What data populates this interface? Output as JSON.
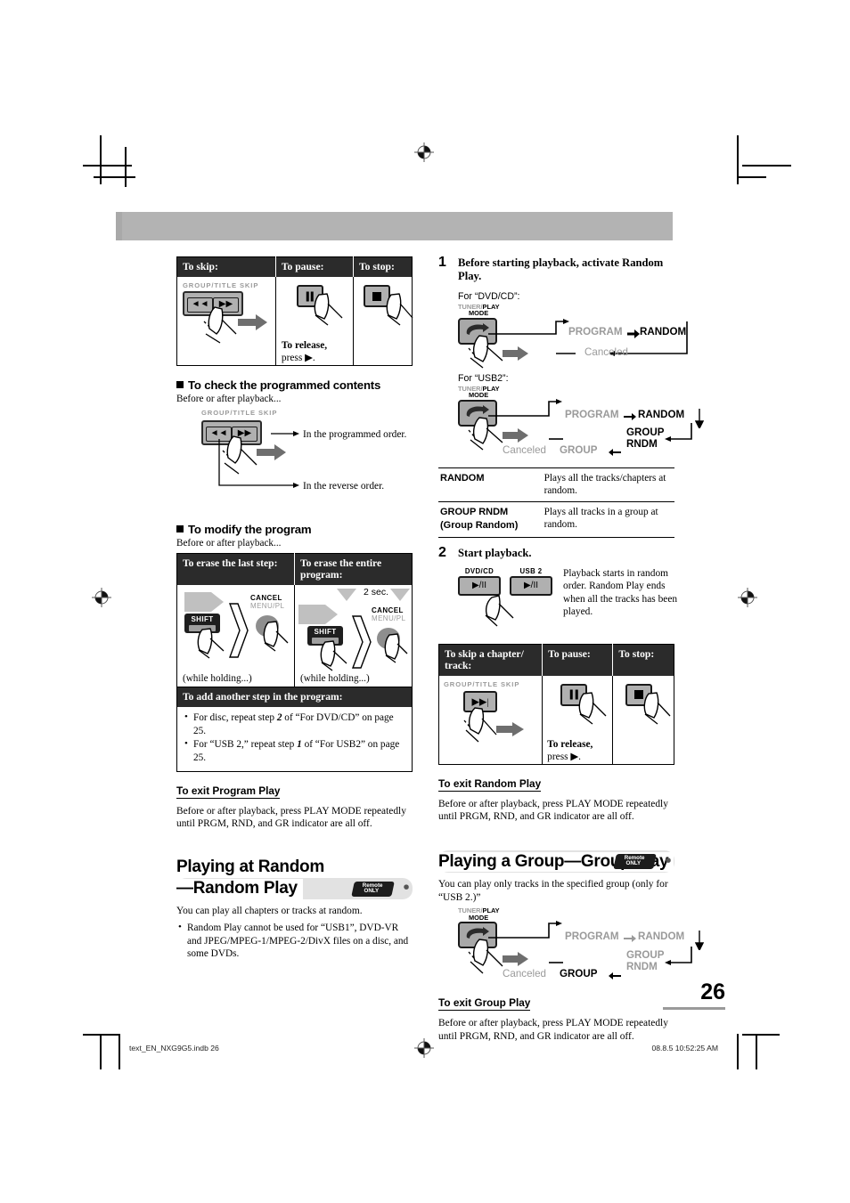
{
  "page": {
    "number": "26"
  },
  "footer": {
    "file": "text_EN_NXG9G5.indb   26",
    "stamp": "08.8.5   10:52:25 AM"
  },
  "left_column": {
    "skip_table": {
      "headers": [
        "To skip:",
        "To pause:",
        "To stop:"
      ],
      "skip_label": "GROUP/TITLE SKIP",
      "pause_note_bold": "To release,",
      "pause_note_rest": "press ▶."
    },
    "check_section": {
      "heading": "To check the programmed contents",
      "pre": "Before or after playback...",
      "skip_label": "GROUP/TITLE SKIP",
      "note_top": "In the programmed order.",
      "note_bottom": "In the reverse order."
    },
    "modify_section": {
      "heading": "To modify the program",
      "pre": "Before or after playback...",
      "headers": [
        "To erase the last step:",
        "To erase the entire program:"
      ],
      "shift_label": "SHIFT",
      "cancel_label": "CANCEL",
      "cancel_sub": "MENU/PL",
      "hold_note": "(while holding...)",
      "two_sec": "2 sec.",
      "band_header": "To add another step in the program:",
      "bullets": [
        "For disc, repeat step 2 of “For DVD/CD” on page 25.",
        "For “USB 2,” repeat step 1 of “For USB2” on page 25."
      ]
    },
    "exit_program": {
      "heading": "To exit Program Play",
      "body": "Before or after playback, press PLAY MODE repeatedly until PRGM, RND, and GR indicator are all off."
    },
    "random_title": {
      "line1": "Playing at Random",
      "line2": "—Random Play",
      "badge_line1": "Remote",
      "badge_line2": "ONLY"
    },
    "random_intro": "You can play all chapters or tracks at random.",
    "random_bullets": [
      "Random Play cannot be used for “USB1”, DVD-VR and JPEG/MPEG-1/MPEG-2/DivX files on a disc, and some DVDs."
    ]
  },
  "right_column": {
    "step1": {
      "num": "1",
      "text": "Before starting playback, activate Random Play.",
      "dvd_label": "For “DVD/CD”:",
      "usb_label": "For “USB2”:",
      "button_top_gray": "TUNER/",
      "button_top_dark": "PLAY",
      "button_bottom": "MODE",
      "dvd_flow": {
        "program": "PROGRAM",
        "random": "RANDOM",
        "canceled": "Canceled"
      },
      "usb_flow": {
        "program": "PROGRAM",
        "random": "RANDOM",
        "group_rndm": "GROUP RNDM",
        "group": "GROUP",
        "canceled": "Canceled"
      }
    },
    "mode_table": {
      "rows": [
        {
          "name": "RANDOM",
          "sub": "",
          "desc": "Plays all the tracks/chapters at random."
        },
        {
          "name": "GROUP RNDM",
          "sub": "(Group Random)",
          "desc": "Plays all tracks in a group at random."
        }
      ]
    },
    "step2": {
      "num": "2",
      "text": "Start playback.",
      "key1_label": "DVD/CD",
      "key2_label": "USB 2",
      "key_glyph": "▶/II",
      "desc": "Playback starts in random order. Random Play ends when all the tracks has been played."
    },
    "random_ops_table": {
      "headers": [
        "To skip a chapter/ track:",
        "To pause:",
        "To stop:"
      ],
      "skip_label": "GROUP/TITLE SKIP",
      "pause_note_bold": "To release,",
      "pause_note_rest": "press ▶."
    },
    "exit_random": {
      "heading": "To exit Random Play",
      "body": "Before or after playback, press PLAY MODE repeatedly until PRGM, RND, and GR indicator are all off."
    },
    "group_title": {
      "text": "Playing a Group—Group Play",
      "badge_line1": "Remote",
      "badge_line2": "ONLY"
    },
    "group_intro": "You can play only tracks in the specified group (only for “USB 2.)”",
    "group_flow": {
      "button_top_gray": "TUNER/",
      "button_top_dark": "PLAY",
      "button_bottom": "MODE",
      "program": "PROGRAM",
      "random": "RANDOM",
      "group_rndm": "GROUP RNDM",
      "group": "GROUP",
      "canceled": "Canceled"
    },
    "exit_group": {
      "heading": "To exit Group Play",
      "body": "Before or after playback, press PLAY MODE repeatedly until PRGM, RND, and GR indicator are all off."
    }
  },
  "colors": {
    "banner": "#b3b3b3",
    "header_black": "#2b2b2b",
    "gray_text": "#9a9a9a",
    "key_face": "#b0b0b0"
  }
}
